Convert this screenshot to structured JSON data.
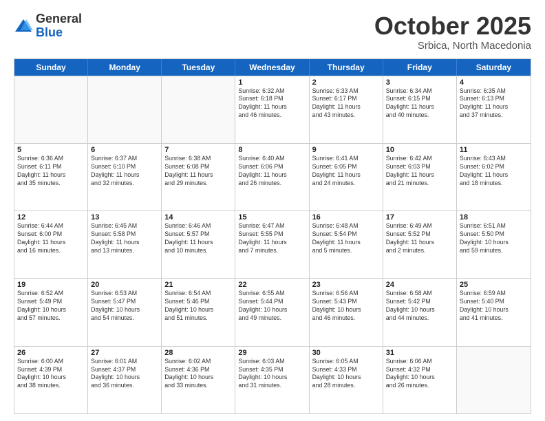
{
  "logo": {
    "general": "General",
    "blue": "Blue"
  },
  "title": "October 2025",
  "location": "Srbica, North Macedonia",
  "header_days": [
    "Sunday",
    "Monday",
    "Tuesday",
    "Wednesday",
    "Thursday",
    "Friday",
    "Saturday"
  ],
  "rows": [
    [
      {
        "day": "",
        "info": ""
      },
      {
        "day": "",
        "info": ""
      },
      {
        "day": "",
        "info": ""
      },
      {
        "day": "1",
        "info": "Sunrise: 6:32 AM\nSunset: 6:18 PM\nDaylight: 11 hours\nand 46 minutes."
      },
      {
        "day": "2",
        "info": "Sunrise: 6:33 AM\nSunset: 6:17 PM\nDaylight: 11 hours\nand 43 minutes."
      },
      {
        "day": "3",
        "info": "Sunrise: 6:34 AM\nSunset: 6:15 PM\nDaylight: 11 hours\nand 40 minutes."
      },
      {
        "day": "4",
        "info": "Sunrise: 6:35 AM\nSunset: 6:13 PM\nDaylight: 11 hours\nand 37 minutes."
      }
    ],
    [
      {
        "day": "5",
        "info": "Sunrise: 6:36 AM\nSunset: 6:11 PM\nDaylight: 11 hours\nand 35 minutes."
      },
      {
        "day": "6",
        "info": "Sunrise: 6:37 AM\nSunset: 6:10 PM\nDaylight: 11 hours\nand 32 minutes."
      },
      {
        "day": "7",
        "info": "Sunrise: 6:38 AM\nSunset: 6:08 PM\nDaylight: 11 hours\nand 29 minutes."
      },
      {
        "day": "8",
        "info": "Sunrise: 6:40 AM\nSunset: 6:06 PM\nDaylight: 11 hours\nand 26 minutes."
      },
      {
        "day": "9",
        "info": "Sunrise: 6:41 AM\nSunset: 6:05 PM\nDaylight: 11 hours\nand 24 minutes."
      },
      {
        "day": "10",
        "info": "Sunrise: 6:42 AM\nSunset: 6:03 PM\nDaylight: 11 hours\nand 21 minutes."
      },
      {
        "day": "11",
        "info": "Sunrise: 6:43 AM\nSunset: 6:02 PM\nDaylight: 11 hours\nand 18 minutes."
      }
    ],
    [
      {
        "day": "12",
        "info": "Sunrise: 6:44 AM\nSunset: 6:00 PM\nDaylight: 11 hours\nand 16 minutes."
      },
      {
        "day": "13",
        "info": "Sunrise: 6:45 AM\nSunset: 5:58 PM\nDaylight: 11 hours\nand 13 minutes."
      },
      {
        "day": "14",
        "info": "Sunrise: 6:46 AM\nSunset: 5:57 PM\nDaylight: 11 hours\nand 10 minutes."
      },
      {
        "day": "15",
        "info": "Sunrise: 6:47 AM\nSunset: 5:55 PM\nDaylight: 11 hours\nand 7 minutes."
      },
      {
        "day": "16",
        "info": "Sunrise: 6:48 AM\nSunset: 5:54 PM\nDaylight: 11 hours\nand 5 minutes."
      },
      {
        "day": "17",
        "info": "Sunrise: 6:49 AM\nSunset: 5:52 PM\nDaylight: 11 hours\nand 2 minutes."
      },
      {
        "day": "18",
        "info": "Sunrise: 6:51 AM\nSunset: 5:50 PM\nDaylight: 10 hours\nand 59 minutes."
      }
    ],
    [
      {
        "day": "19",
        "info": "Sunrise: 6:52 AM\nSunset: 5:49 PM\nDaylight: 10 hours\nand 57 minutes."
      },
      {
        "day": "20",
        "info": "Sunrise: 6:53 AM\nSunset: 5:47 PM\nDaylight: 10 hours\nand 54 minutes."
      },
      {
        "day": "21",
        "info": "Sunrise: 6:54 AM\nSunset: 5:46 PM\nDaylight: 10 hours\nand 51 minutes."
      },
      {
        "day": "22",
        "info": "Sunrise: 6:55 AM\nSunset: 5:44 PM\nDaylight: 10 hours\nand 49 minutes."
      },
      {
        "day": "23",
        "info": "Sunrise: 6:56 AM\nSunset: 5:43 PM\nDaylight: 10 hours\nand 46 minutes."
      },
      {
        "day": "24",
        "info": "Sunrise: 6:58 AM\nSunset: 5:42 PM\nDaylight: 10 hours\nand 44 minutes."
      },
      {
        "day": "25",
        "info": "Sunrise: 6:59 AM\nSunset: 5:40 PM\nDaylight: 10 hours\nand 41 minutes."
      }
    ],
    [
      {
        "day": "26",
        "info": "Sunrise: 6:00 AM\nSunset: 4:39 PM\nDaylight: 10 hours\nand 38 minutes."
      },
      {
        "day": "27",
        "info": "Sunrise: 6:01 AM\nSunset: 4:37 PM\nDaylight: 10 hours\nand 36 minutes."
      },
      {
        "day": "28",
        "info": "Sunrise: 6:02 AM\nSunset: 4:36 PM\nDaylight: 10 hours\nand 33 minutes."
      },
      {
        "day": "29",
        "info": "Sunrise: 6:03 AM\nSunset: 4:35 PM\nDaylight: 10 hours\nand 31 minutes."
      },
      {
        "day": "30",
        "info": "Sunrise: 6:05 AM\nSunset: 4:33 PM\nDaylight: 10 hours\nand 28 minutes."
      },
      {
        "day": "31",
        "info": "Sunrise: 6:06 AM\nSunset: 4:32 PM\nDaylight: 10 hours\nand 26 minutes."
      },
      {
        "day": "",
        "info": ""
      }
    ]
  ]
}
